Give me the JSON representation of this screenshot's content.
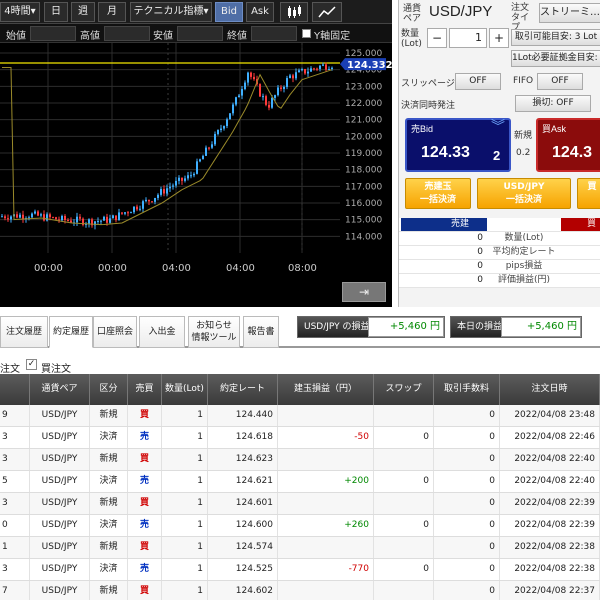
{
  "toolbar": {
    "period": "4時間▾",
    "btn_day": "日",
    "btn_week": "週",
    "btn_month": "月",
    "technical": "テクニカル指標▾",
    "bid": "Bid",
    "ask": "Ask"
  },
  "ohlc": {
    "open_label": "始値",
    "high_label": "高値",
    "low_label": "安値",
    "close_label": "終値",
    "yfix_label": "Y軸固定"
  },
  "chart_data": {
    "type": "candlestick",
    "y_ticks": [
      "125.000",
      "124.000",
      "123.000",
      "122.000",
      "121.000",
      "120.000",
      "119.000",
      "118.000",
      "117.000",
      "116.000",
      "115.000",
      "114.000"
    ],
    "x_ticks": [
      "00:00",
      "00:00",
      "04:00",
      "04:00",
      "08:00"
    ],
    "ylim": [
      113.6,
      125.3
    ],
    "current_price": "124.332",
    "current_value": 124.332,
    "ma_color": "#9a8a2a",
    "up_color": "#3fb0ff",
    "down_color": "#ff3b3b",
    "line_color": "#f2e600"
  },
  "order": {
    "pair_label": "通貨ペア",
    "pair": "USD/JPY",
    "type_label": "注文タイプ",
    "type_value": "ストリーミ…",
    "qty_label": "数量(Lot)",
    "qty": "1",
    "minus": "−",
    "plus": "+",
    "capacity": "取引可能目安: 3 Lot",
    "margin_req": "1Lot必要証拠金目安: 4",
    "slippage_label": "スリッページ",
    "slippage": "OFF",
    "fifo_label": "FIFO",
    "fifo": "OFF",
    "settle_label": "決済同時発注",
    "settle": "損切: OFF",
    "bid_label": "売Bid",
    "bid_main": "124.33",
    "bid_last": "2",
    "spread_label": "新規",
    "spread": "0.2",
    "ask_label": "買Ask",
    "ask_main": "124.3",
    "btn_sell_all_1": "売建玉",
    "btn_sell_all_2": "一括決済",
    "btn_pair_all_1": "USD/JPY",
    "btn_pair_all_2": "一括決済",
    "btn_buy_all_1": "買",
    "btn_buy_all_2": "",
    "pos_sell_header": "売建",
    "pos_buy_header": "買",
    "pos_rows": [
      {
        "val": "0",
        "label": "数量(Lot)"
      },
      {
        "val": "0",
        "label": "平均約定レート"
      },
      {
        "val": "0",
        "label": "pips損益"
      },
      {
        "val": "0",
        "label": "評価損益(円)"
      }
    ]
  },
  "tabs": [
    {
      "label": "注文履歴",
      "label2": ""
    },
    {
      "label": "約定履歴",
      "label2": ""
    },
    {
      "label": "口座照会",
      "label2": ""
    },
    {
      "label": "入出金",
      "label2": ""
    },
    {
      "label": "お知らせ",
      "label2": "情報ツール"
    },
    {
      "label": "報告書",
      "label2": ""
    }
  ],
  "summary": {
    "pair_pl_label": "USD/JPY の損益",
    "pair_pl_value": "+5,460 円",
    "today_pl_label": "本日の損益",
    "today_pl_value": "+5,460 円"
  },
  "filters": {
    "sell_label": "注文",
    "buy_label": "買注文"
  },
  "history": {
    "columns": [
      "",
      "通貨ペア",
      "区分",
      "売買",
      "数量(Lot)",
      "約定レート",
      "建玉損益（円）",
      "スワップ",
      "取引手数料",
      "注文日時"
    ],
    "rows": [
      {
        "id": "9",
        "pair": "USD/JPY",
        "kind": "新規",
        "side": "買",
        "side_color": "#d00000",
        "qty": "1",
        "rate": "124.440",
        "pl": "",
        "pl_color": "#000",
        "swap": "",
        "fee": "0",
        "time": "2022/04/08 23:48"
      },
      {
        "id": "3",
        "pair": "USD/JPY",
        "kind": "決済",
        "side": "売",
        "side_color": "#0030c0",
        "qty": "1",
        "rate": "124.618",
        "pl": "-50",
        "pl_color": "#d00000",
        "swap": "0",
        "fee": "0",
        "time": "2022/04/08 22:46"
      },
      {
        "id": "3",
        "pair": "USD/JPY",
        "kind": "新規",
        "side": "買",
        "side_color": "#d00000",
        "qty": "1",
        "rate": "124.623",
        "pl": "",
        "pl_color": "#000",
        "swap": "",
        "fee": "0",
        "time": "2022/04/08 22:40"
      },
      {
        "id": "5",
        "pair": "USD/JPY",
        "kind": "決済",
        "side": "売",
        "side_color": "#0030c0",
        "qty": "1",
        "rate": "124.621",
        "pl": "+200",
        "pl_color": "#008800",
        "swap": "0",
        "fee": "0",
        "time": "2022/04/08 22:40"
      },
      {
        "id": "3",
        "pair": "USD/JPY",
        "kind": "新規",
        "side": "買",
        "side_color": "#d00000",
        "qty": "1",
        "rate": "124.601",
        "pl": "",
        "pl_color": "#000",
        "swap": "",
        "fee": "0",
        "time": "2022/04/08 22:39"
      },
      {
        "id": "0",
        "pair": "USD/JPY",
        "kind": "決済",
        "side": "売",
        "side_color": "#0030c0",
        "qty": "1",
        "rate": "124.600",
        "pl": "+260",
        "pl_color": "#008800",
        "swap": "0",
        "fee": "0",
        "time": "2022/04/08 22:39"
      },
      {
        "id": "1",
        "pair": "USD/JPY",
        "kind": "新規",
        "side": "買",
        "side_color": "#d00000",
        "qty": "1",
        "rate": "124.574",
        "pl": "",
        "pl_color": "#000",
        "swap": "",
        "fee": "0",
        "time": "2022/04/08 22:38"
      },
      {
        "id": "3",
        "pair": "USD/JPY",
        "kind": "決済",
        "side": "売",
        "side_color": "#0030c0",
        "qty": "1",
        "rate": "124.525",
        "pl": "-770",
        "pl_color": "#d00000",
        "swap": "0",
        "fee": "0",
        "time": "2022/04/08 22:38"
      },
      {
        "id": "7",
        "pair": "USD/JPY",
        "kind": "新規",
        "side": "買",
        "side_color": "#d00000",
        "qty": "1",
        "rate": "124.602",
        "pl": "",
        "pl_color": "#000",
        "swap": "",
        "fee": "0",
        "time": "2022/04/08 22:37"
      }
    ]
  }
}
